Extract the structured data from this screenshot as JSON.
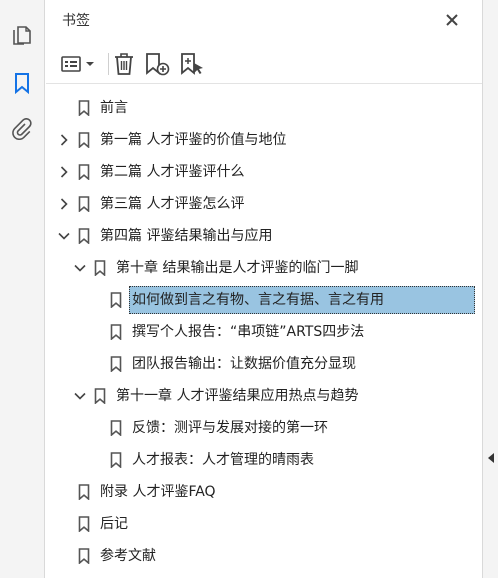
{
  "panel": {
    "title": "书签"
  },
  "rail": {
    "icons": [
      "pages-icon",
      "bookmark-icon",
      "attachment-icon"
    ],
    "active": "bookmark-icon"
  },
  "toolbar": {
    "buttons": [
      "options-menu-icon",
      "delete-icon",
      "new-bookmark-icon",
      "bookmark-from-selection-icon"
    ]
  },
  "colors": {
    "selection": "#99c4e1",
    "accent": "#1473e6"
  },
  "bookmarks": [
    {
      "label": "前言",
      "level": 0,
      "twisty": "none"
    },
    {
      "label": "第一篇 人才评鉴的价值与地位",
      "level": 0,
      "twisty": "collapsed"
    },
    {
      "label": "第二篇 人才评鉴评什么",
      "level": 0,
      "twisty": "collapsed"
    },
    {
      "label": "第三篇 人才评鉴怎么评",
      "level": 0,
      "twisty": "collapsed"
    },
    {
      "label": "第四篇 评鉴结果输出与应用",
      "level": 0,
      "twisty": "expanded"
    },
    {
      "label": "第十章 结果输出是人才评鉴的临门一脚",
      "level": 1,
      "twisty": "expanded"
    },
    {
      "label": "如何做到言之有物、言之有据、言之有用",
      "level": 2,
      "twisty": "none",
      "selected": true
    },
    {
      "label": "撰写个人报告：“串项链”ARTS四步法",
      "level": 2,
      "twisty": "none"
    },
    {
      "label": "团队报告输出：让数据价值充分显现",
      "level": 2,
      "twisty": "none"
    },
    {
      "label": "第十一章 人才评鉴结果应用热点与趋势",
      "level": 1,
      "twisty": "expanded"
    },
    {
      "label": "反馈：测评与发展对接的第一环",
      "level": 2,
      "twisty": "none"
    },
    {
      "label": "人才报表：人才管理的晴雨表",
      "level": 2,
      "twisty": "none"
    },
    {
      "label": "附录 人才评鉴FAQ",
      "level": 0,
      "twisty": "none"
    },
    {
      "label": "后记",
      "level": 0,
      "twisty": "none"
    },
    {
      "label": "参考文献",
      "level": 0,
      "twisty": "none"
    }
  ]
}
